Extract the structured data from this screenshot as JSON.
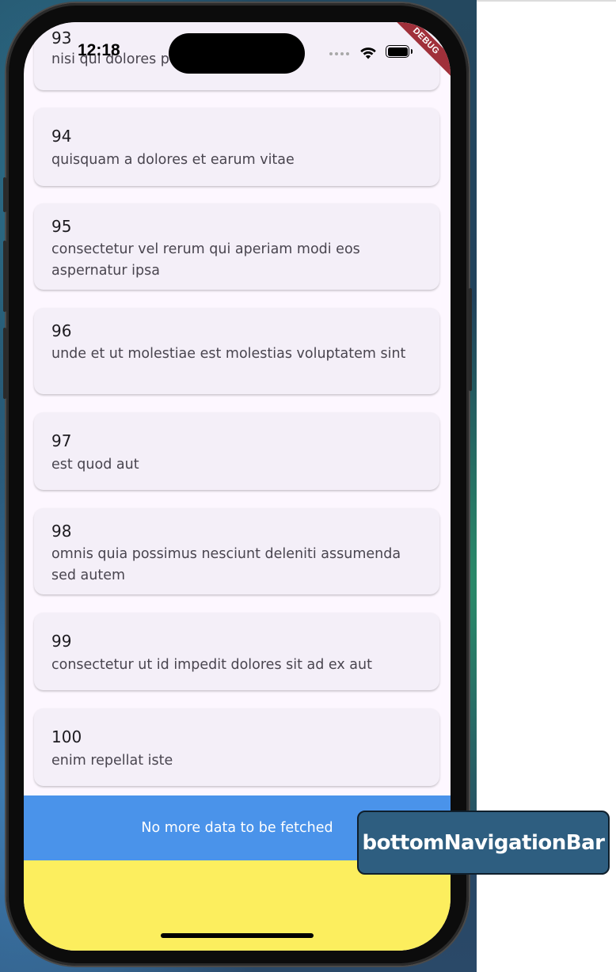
{
  "status_bar": {
    "time": "12:18",
    "debug_label": "DEBUG"
  },
  "list": {
    "items": [
      {
        "id": "93",
        "body": "nisi qui dolores p"
      },
      {
        "id": "94",
        "body": "quisquam a dolores et earum vitae"
      },
      {
        "id": "95",
        "body": "consectetur vel rerum qui aperiam modi eos aspernatur ipsa"
      },
      {
        "id": "96",
        "body": "unde et ut molestiae est molestias voluptatem sint"
      },
      {
        "id": "97",
        "body": "est quod aut"
      },
      {
        "id": "98",
        "body": "omnis quia possimus nesciunt deleniti assumenda sed autem"
      },
      {
        "id": "99",
        "body": "consectetur ut id impedit dolores sit ad ex aut"
      },
      {
        "id": "100",
        "body": "enim repellat iste"
      }
    ]
  },
  "footer": {
    "message": "No more data to be fetched"
  },
  "callout": {
    "label": "bottomNavigationBar"
  },
  "colors": {
    "screen_background": "#fdf7ff",
    "card_background": "#f4eff8",
    "footer_background": "#4a93ea",
    "bottom_bar_background": "#fcee5e",
    "callout_background": "#2e5e80",
    "debug_banner": "#a0303a"
  }
}
